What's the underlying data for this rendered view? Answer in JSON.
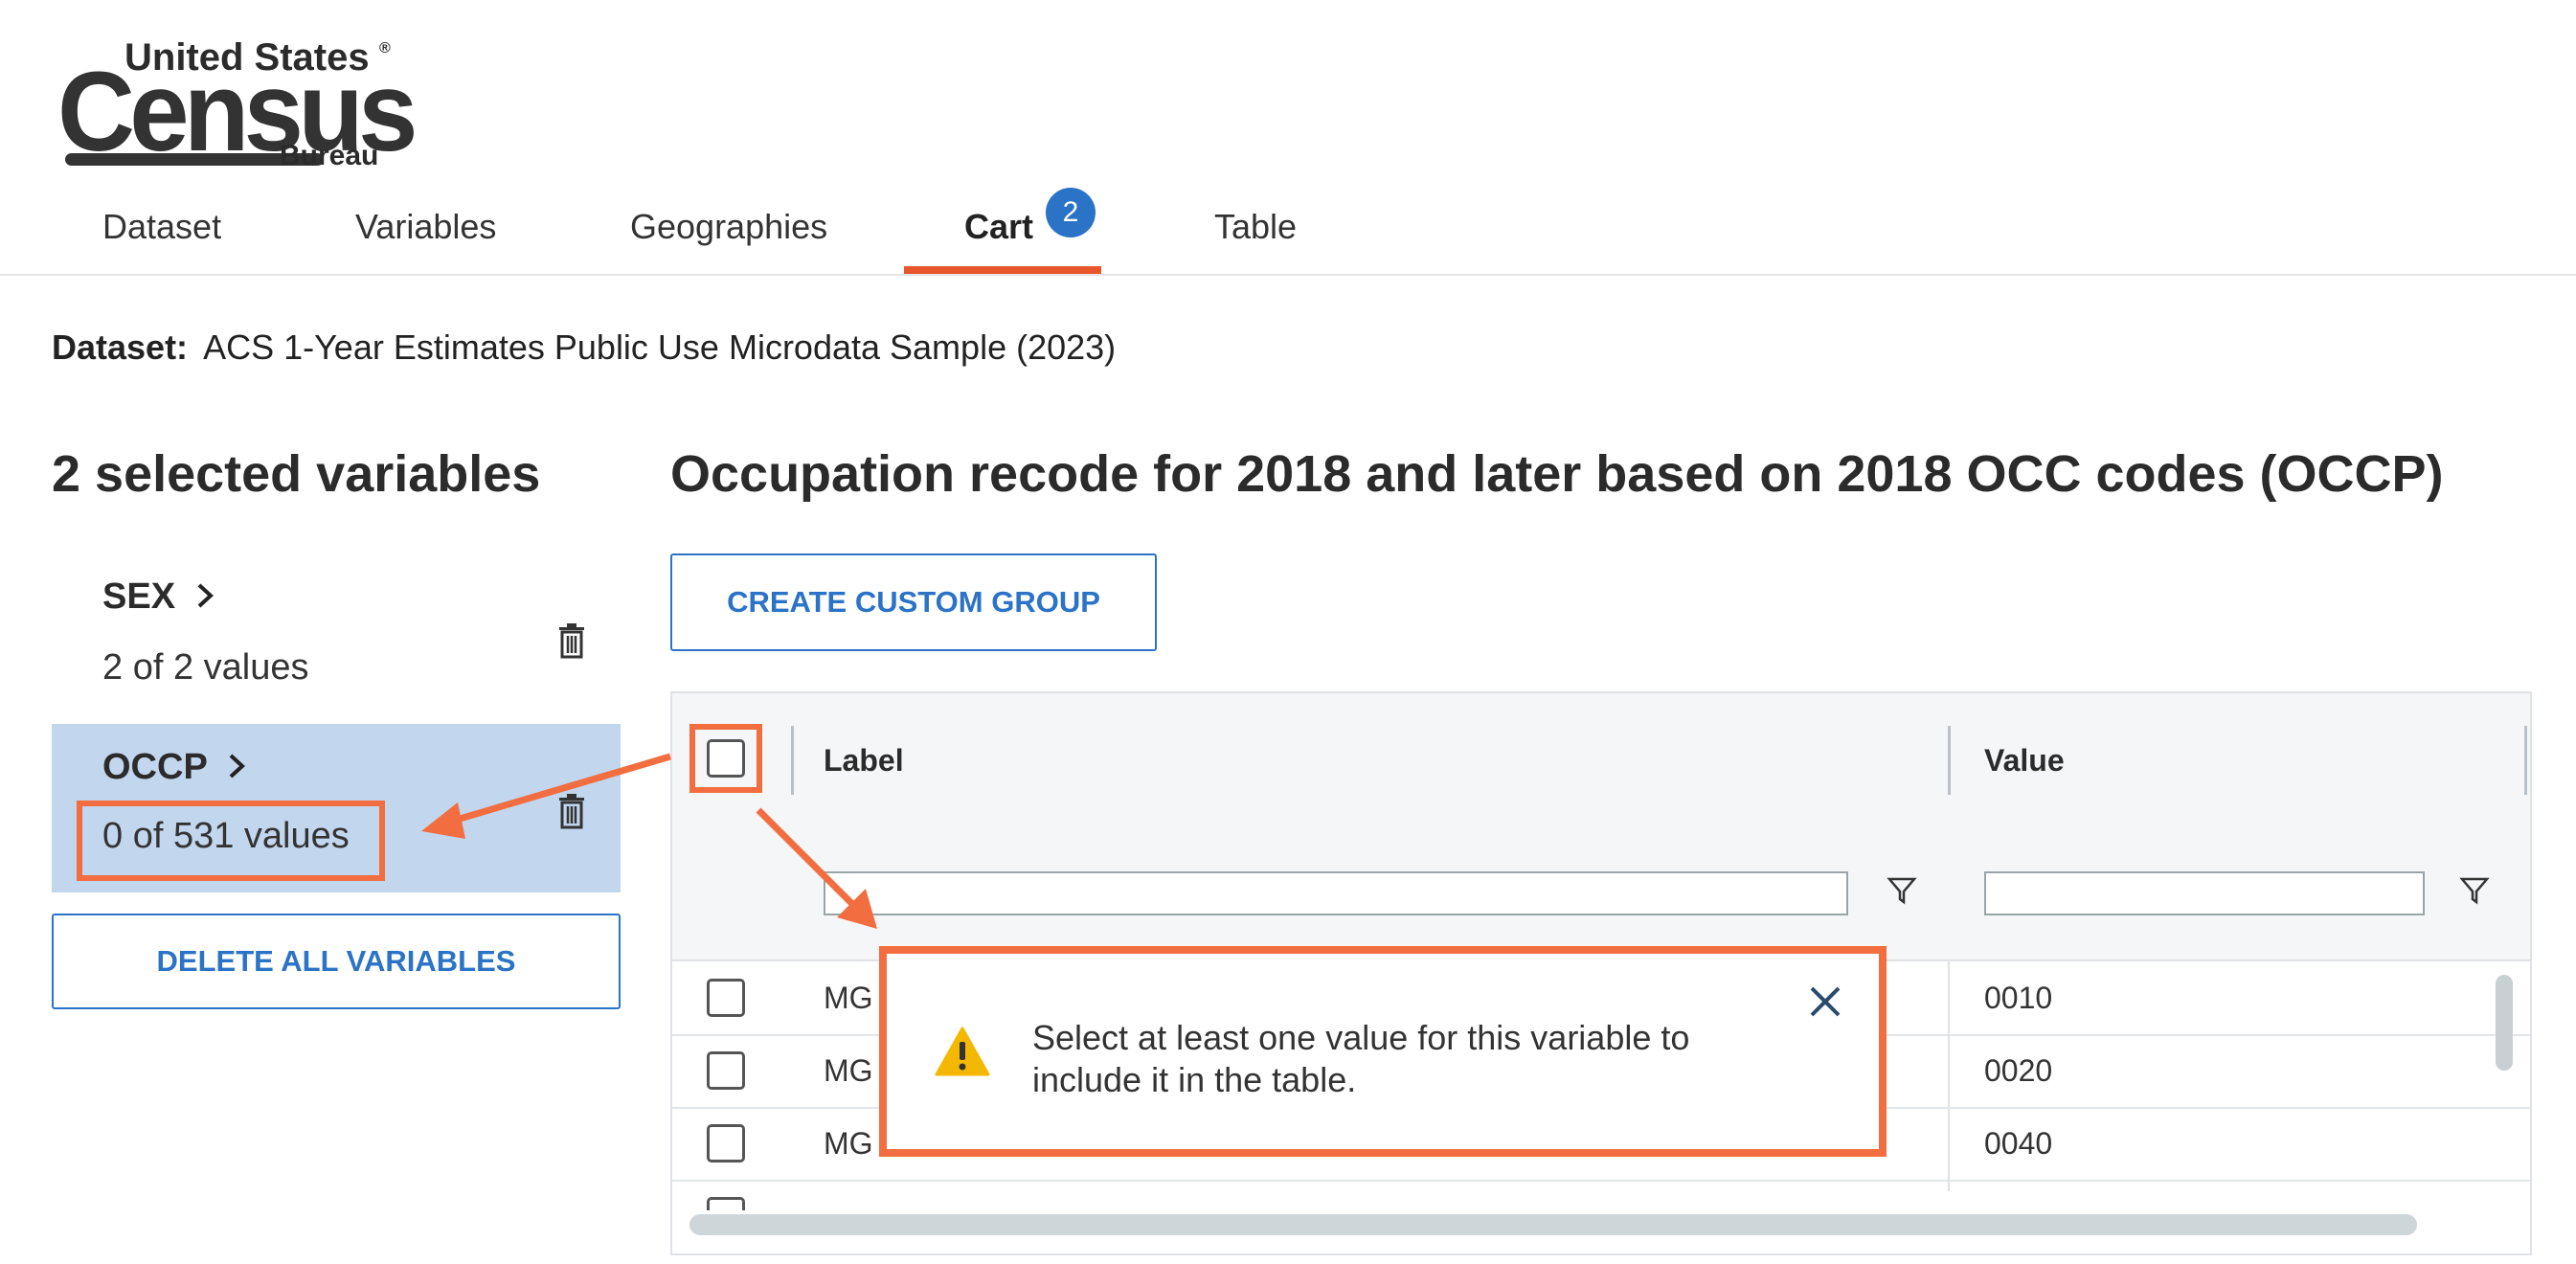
{
  "logo": {
    "line1": "United States",
    "registered": "®",
    "line2": "Census",
    "line3": "Bureau"
  },
  "nav": {
    "tabs": [
      {
        "label": "Dataset"
      },
      {
        "label": "Variables"
      },
      {
        "label": "Geographies"
      },
      {
        "label": "Cart",
        "badge": "2",
        "active": true
      },
      {
        "label": "Table"
      }
    ]
  },
  "dataset": {
    "label": "Dataset:",
    "value": "ACS 1-Year Estimates Public Use Microdata Sample (2023)"
  },
  "sidebar": {
    "title": "2 selected variables",
    "variables": [
      {
        "name": "SEX",
        "summary": "2 of 2 values"
      },
      {
        "name": "OCCP",
        "summary": "0 of 531 values",
        "selected": true
      }
    ],
    "delete_all_label": "DELETE ALL VARIABLES"
  },
  "main": {
    "title": "Occupation recode for 2018 and later based on 2018 OCC codes (OCCP)",
    "create_group_label": "CREATE CUSTOM GROUP",
    "table": {
      "columns": [
        "Label",
        "Value"
      ],
      "rows": [
        {
          "label": "MG",
          "value": "0010"
        },
        {
          "label": "MG",
          "value": "0020"
        },
        {
          "label": "MG",
          "value": "0040"
        }
      ]
    }
  },
  "toast": {
    "message": "Select at least one value for this variable to include it in the table."
  },
  "colors": {
    "accent_orange": "#e8562b",
    "callout_orange": "#f26d40",
    "brand_blue": "#2b73c6",
    "selected_bg": "#c2d6ee",
    "warning_yellow": "#f5b800"
  },
  "icons": [
    "trash-icon",
    "chevron-right-icon",
    "filter-icon",
    "close-icon",
    "warning-icon"
  ]
}
